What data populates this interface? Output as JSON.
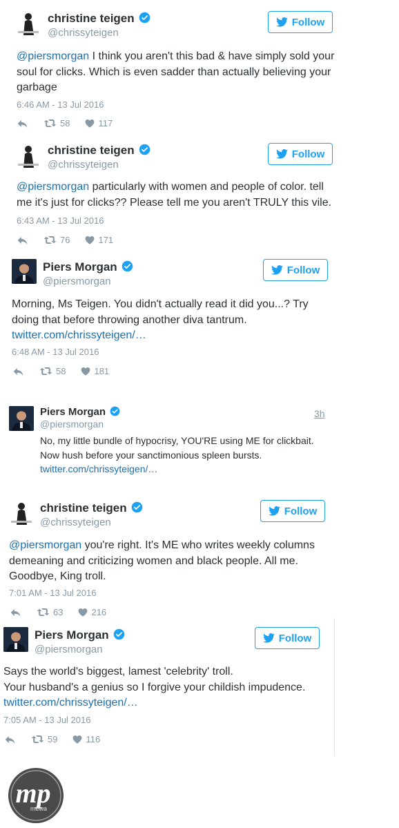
{
  "tweets": [
    {
      "name": "christine teigen",
      "handle": "@chrissyteigen",
      "follow_label": "Follow",
      "mention": "@piersmorgan",
      "text": " I think you aren't this bad & have simply sold your soul for clicks. Which is even sadder than actually believing your garbage",
      "time": "6:46 AM - 13 Jul 2016",
      "retweets": "58",
      "likes": "117"
    },
    {
      "name": "christine teigen",
      "handle": "@chrissyteigen",
      "follow_label": "Follow",
      "mention": "@piersmorgan",
      "text": " particularly with women and people of color. tell me it's just for clicks?? Please tell me you aren't TRULY this vile.",
      "time": "6:43 AM - 13 Jul 2016",
      "retweets": "76",
      "likes": "171"
    },
    {
      "name": "Piers Morgan",
      "handle": "@piersmorgan",
      "follow_label": "Follow",
      "text": "Morning, Ms Teigen. You didn't actually read it did you...? Try doing that before throwing another diva tantrum.",
      "link": "twitter.com/chrissyteigen/…",
      "time": "6:48 AM - 13 Jul 2016",
      "retweets": "58",
      "likes": "181"
    },
    {
      "name": "Piers Morgan",
      "handle": "@piersmorgan",
      "age": "3h",
      "text_line1": "No, my little bundle of hypocrisy, YOU'RE using ME for clickbait.",
      "text_line2": "Now hush before your sanctimonious spleen bursts.",
      "link": "twitter.com/chrissyteigen/…"
    },
    {
      "name": "christine teigen",
      "handle": "@chrissyteigen",
      "follow_label": "Follow",
      "mention": "@piersmorgan",
      "text": " you're right. It's ME who writes weekly columns demeaning and criticizing women and black people. All me. Goodbye, King troll.",
      "time": "7:01 AM - 13 Jul 2016",
      "retweets": "63",
      "likes": "216"
    },
    {
      "name": "Piers Morgan",
      "handle": "@piersmorgan",
      "follow_label": "Follow",
      "text_line1": "Says the world's biggest, lamest 'celebrity' troll.",
      "text_line2": "Your husband's a genius so I forgive your childish impudence.",
      "link": "twitter.com/chrissyteigen/…",
      "time": "7:05 AM - 13 Jul 2016",
      "retweets": "59",
      "likes": "116"
    }
  ],
  "watermark": {
    "letters": "mp",
    "tagline": "mewa"
  },
  "colors": {
    "accent": "#1da1f2",
    "link": "#1b6fae",
    "muted": "#8899a6",
    "verified": "#1da1f2"
  },
  "icons": [
    "reply-icon",
    "retweet-icon",
    "like-icon",
    "twitter-bird-icon",
    "verified-badge-icon"
  ]
}
